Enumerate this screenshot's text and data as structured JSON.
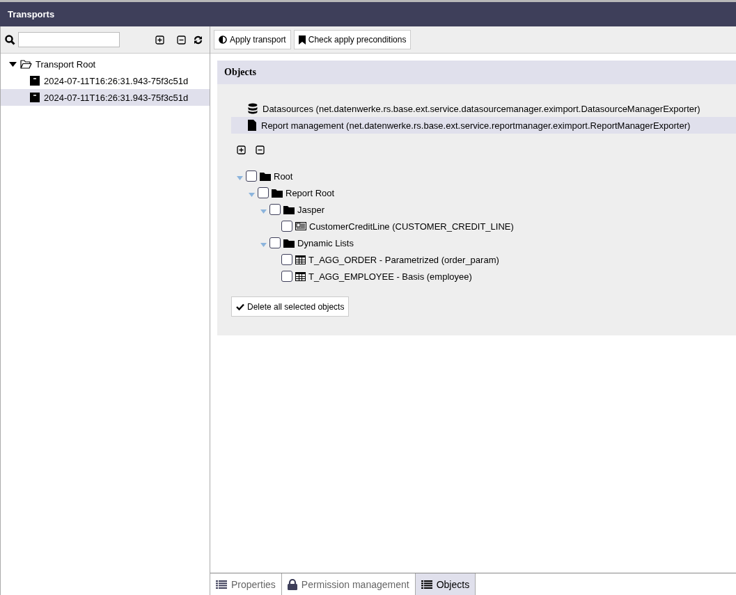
{
  "window": {
    "title": "Transports"
  },
  "transport_tree": {
    "label": "Transport Root",
    "expanded": true,
    "children": [
      {
        "label": "2024-07-11T16:26:31.943-75f3c51d",
        "selected": false
      },
      {
        "label": "2024-07-11T16:26:31.943-75f3c51d",
        "selected": true
      }
    ]
  },
  "toolbar": {
    "buttons": [
      {
        "label": "Apply transport",
        "kind": "apply"
      },
      {
        "label": "Check apply preconditions",
        "kind": "check"
      }
    ]
  },
  "objects_panel": {
    "title": "Objects",
    "exporters": [
      {
        "label": "Datasources (net.datenwerke.rs.base.ext.service.datasourcemanager.eximport.DatasourceManagerExporter)",
        "kind": "database",
        "selected": false
      },
      {
        "label": "Report management (net.datenwerke.rs.base.ext.service.reportmanager.eximport.ReportManagerExporter)",
        "kind": "file",
        "selected": true
      }
    ],
    "tree": [
      {
        "label": "Root",
        "kind": "folder",
        "checked": false,
        "expanded": true,
        "children": [
          {
            "label": "Report Root",
            "kind": "folder",
            "checked": false,
            "expanded": true,
            "children": [
              {
                "label": "Jasper",
                "kind": "folder",
                "checked": false,
                "expanded": true,
                "children": [
                  {
                    "label": "CustomerCreditLine (CUSTOMER_CREDIT_LINE)",
                    "kind": "report",
                    "checked": false
                  }
                ]
              },
              {
                "label": "Dynamic Lists",
                "kind": "folder",
                "checked": false,
                "expanded": true,
                "children": [
                  {
                    "label": "T_AGG_ORDER - Parametrized (order_param)",
                    "kind": "table",
                    "checked": false
                  },
                  {
                    "label": "T_AGG_EMPLOYEE - Basis (employee)",
                    "kind": "table",
                    "checked": false
                  }
                ]
              }
            ]
          }
        ]
      }
    ],
    "delete_button": "Delete all selected objects"
  },
  "bottom_tabs": [
    {
      "label": "Properties",
      "kind": "list",
      "selected": false
    },
    {
      "label": "Permission management",
      "kind": "lock",
      "selected": false
    },
    {
      "label": "Objects",
      "kind": "list",
      "selected": true
    }
  ]
}
